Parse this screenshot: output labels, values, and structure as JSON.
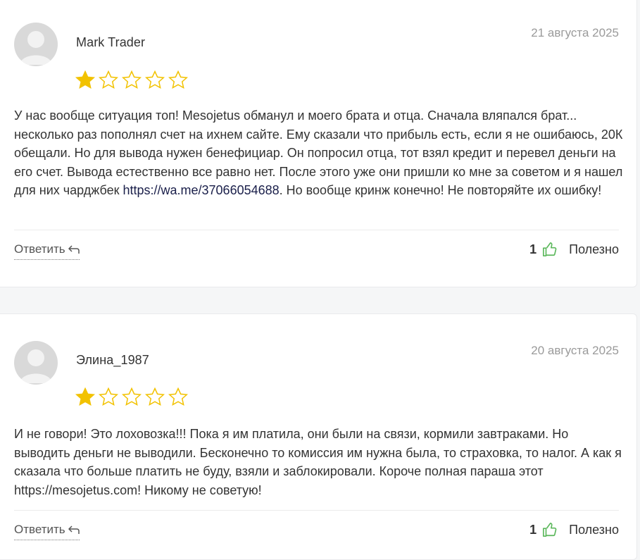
{
  "reviews": [
    {
      "author": "Mark Trader",
      "date": "21 августа 2025",
      "rating": 1,
      "max_rating": 5,
      "text_before_link": "У нас вообще ситуация топ! Mesojetus обманул и моего брата и отца. Сначала вляпался брат... несколько раз пополнял счет на ихнем сайте. Ему сказали что прибыль есть, если я не ошибаюсь, 20К обещали. Но для вывода нужен бенефициар. Он попросил отца, тот взял кредит и перевел деньги на его счет. Вывода естественно все равно нет. После этого уже они пришли ко мне за советом и я нашел для них чарджбек ",
      "link": "https://wa.me/37066054688",
      "text_after_link": ". Но вообще кринж конечно! Не повторяйте их ошибку!",
      "reply_label": "Ответить",
      "likes": "1",
      "useful_label": "Полезно"
    },
    {
      "author": "Элина_1987",
      "date": "20 августа 2025",
      "rating": 1,
      "max_rating": 5,
      "text_before_link": "И не говори! Это лоховозка!!! Пока я им платила, они были на связи, кормили завтраками. Но выводить деньги не выводили. Бесконечно то комиссия им нужна была, то страховка, то налог. А как я сказала что больше платить не буду, взяли и заблокировали. Короче полная параша этот https://mesojetus.com! Никому не советую!",
      "link": "",
      "text_after_link": "",
      "reply_label": "Ответить",
      "likes": "1",
      "useful_label": "Полезно"
    }
  ],
  "colors": {
    "star_filled": "#f2c200",
    "star_outline": "#f2c200",
    "thumb": "#5cb85c",
    "avatar_bg": "#d9d9d9"
  }
}
